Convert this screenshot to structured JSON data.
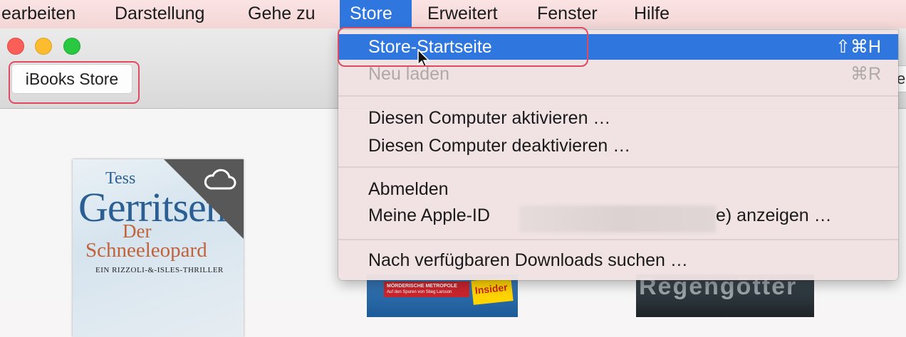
{
  "menubar": {
    "items": [
      {
        "label": "earbeiten"
      },
      {
        "label": "Darstellung"
      },
      {
        "label": "Gehe zu"
      },
      {
        "label": "Store"
      },
      {
        "label": "Erweitert"
      },
      {
        "label": "Fenster"
      },
      {
        "label": "Hilfe"
      }
    ],
    "active": "Store"
  },
  "toolbar": {
    "store_button": "iBooks Store",
    "right_field_fragment": "er"
  },
  "menu": {
    "items": [
      {
        "label": "Store-Startseite",
        "shortcut": "⇧⌘H",
        "state": "highlighted"
      },
      {
        "label": "Neu laden",
        "shortcut": "⌘R",
        "state": "disabled"
      },
      {
        "label": "Diesen Computer aktivieren …"
      },
      {
        "label": "Diesen Computer deaktivieren …"
      },
      {
        "label": "Abmelden"
      },
      {
        "label": "Meine Apple-ID",
        "suffix": "e) anzeigen …"
      },
      {
        "label": "Nach verfügbaren Downloads suchen …"
      }
    ]
  },
  "books": {
    "book1": {
      "author_first": "Tess",
      "author_last": "Gerritsen",
      "title_1": "Der",
      "title_2": "Schneeleopard",
      "subtitle": "EIN RIZZOLI-&-ISLES-THRILLER",
      "icon": "icloud-icon"
    },
    "book2": {
      "line1": "MÖRDERISCHE METROPOLE",
      "line2": "Auf den Spuren von Stieg Larsson",
      "badge": "Insider"
    },
    "book3": {
      "title_fragment": "Regengötter"
    }
  },
  "colors": {
    "menubar_bg": "#f3d6d6",
    "highlight": "#2f76de",
    "annotation": "#e04a60"
  }
}
